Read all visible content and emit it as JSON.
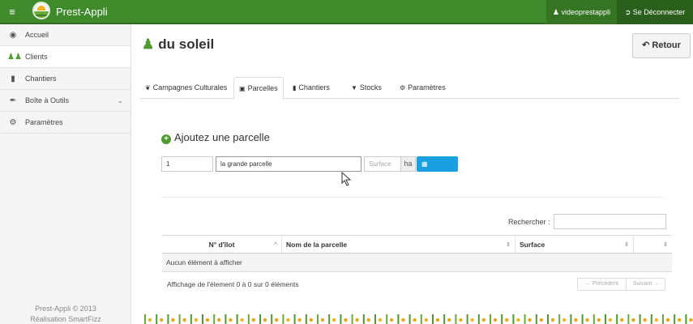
{
  "topbar": {
    "app_name": "Prest-Appli",
    "menu_icon": "hamburger-icon",
    "user_label": "videoprestappli",
    "logout_label": "Se Déconnecter",
    "color": "#3f8a2a"
  },
  "sidebar": {
    "items": [
      {
        "label": "Accueil",
        "icon": "dashboard-icon"
      },
      {
        "label": "Clients",
        "icon": "users-icon",
        "active": true
      },
      {
        "label": "Chantiers",
        "icon": "book-icon"
      },
      {
        "label": "Boîte à Outils",
        "icon": "tools-icon",
        "has_chevron": true
      },
      {
        "label": "Paramètres",
        "icon": "gear-icon"
      }
    ],
    "footer_line1": "Prest-Appli © 2013",
    "footer_line2": "Réalisation SmartFizz"
  },
  "page": {
    "title": "du soleil",
    "back_label": "Retour"
  },
  "tabs": [
    {
      "label": "Campagnes Culturales",
      "icon": "leaf-icon"
    },
    {
      "label": "Parcelles",
      "icon": "picture-icon",
      "active": true
    },
    {
      "label": "Chantiers",
      "icon": "book-icon"
    },
    {
      "label": "Stocks",
      "icon": "inbox-icon"
    },
    {
      "label": "Paramètres",
      "icon": "gear-icon"
    }
  ],
  "form": {
    "title": "Ajoutez une parcelle",
    "ilot_value": "1",
    "name_value": "la grande parcelle",
    "surface_placeholder": "Surface",
    "unit": "ha",
    "save_label": "Enregistrer"
  },
  "table": {
    "search_label": "Rechercher :",
    "columns": [
      "N° d'îlot",
      "Nom de la parcelle",
      "Surface",
      ""
    ],
    "empty_text": "Aucun élément à afficher",
    "info": "Affichage de l'élement 0 à 0 sur 0 éléments",
    "prev_label": "← Précédent",
    "next_label": "Suivant →"
  },
  "colors": {
    "accent": "#4e9b2f",
    "primary_button": "#1a9fe0"
  }
}
